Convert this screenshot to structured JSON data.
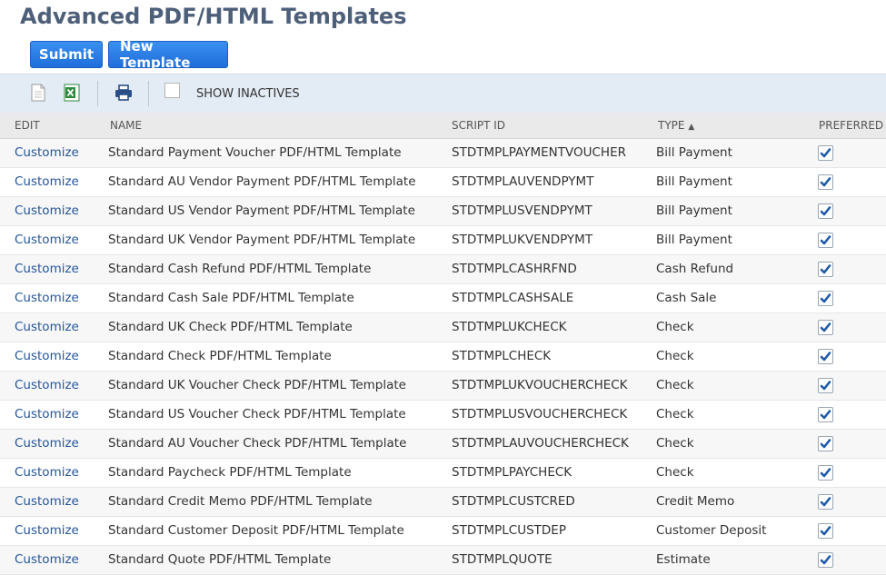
{
  "page": {
    "title": "Advanced PDF/HTML Templates"
  },
  "buttons": {
    "submit": "Submit",
    "new_template": "New Template"
  },
  "toolbar": {
    "show_inactives": "SHOW INACTIVES"
  },
  "columns": {
    "edit": "EDIT",
    "name": "NAME",
    "script_id": "SCRIPT ID",
    "type": "TYPE",
    "sort_indicator": "▲",
    "preferred": "PREFERRED"
  },
  "colors": {
    "title": "#4d5f79",
    "button": "#1f6fdc",
    "link": "#255599",
    "checkmark": "#1e5aa8",
    "toolbar_bg": "#e3ebf4"
  },
  "rows": [
    {
      "edit": "Customize",
      "name": "Standard Payment Voucher PDF/HTML Template",
      "script_id": "STDTMPLPAYMENTVOUCHER",
      "type": "Bill Payment",
      "preferred": true
    },
    {
      "edit": "Customize",
      "name": "Standard AU Vendor Payment PDF/HTML Template",
      "script_id": "STDTMPLAUVENDPYMT",
      "type": "Bill Payment",
      "preferred": true
    },
    {
      "edit": "Customize",
      "name": "Standard US Vendor Payment PDF/HTML Template",
      "script_id": "STDTMPLUSVENDPYMT",
      "type": "Bill Payment",
      "preferred": true
    },
    {
      "edit": "Customize",
      "name": "Standard UK Vendor Payment PDF/HTML Template",
      "script_id": "STDTMPLUKVENDPYMT",
      "type": "Bill Payment",
      "preferred": true
    },
    {
      "edit": "Customize",
      "name": "Standard Cash Refund PDF/HTML Template",
      "script_id": "STDTMPLCASHRFND",
      "type": "Cash Refund",
      "preferred": true
    },
    {
      "edit": "Customize",
      "name": "Standard Cash Sale PDF/HTML Template",
      "script_id": "STDTMPLCASHSALE",
      "type": "Cash Sale",
      "preferred": true
    },
    {
      "edit": "Customize",
      "name": "Standard UK Check PDF/HTML Template",
      "script_id": "STDTMPLUKCHECK",
      "type": "Check",
      "preferred": true
    },
    {
      "edit": "Customize",
      "name": "Standard Check PDF/HTML Template",
      "script_id": "STDTMPLCHECK",
      "type": "Check",
      "preferred": true
    },
    {
      "edit": "Customize",
      "name": "Standard UK Voucher Check PDF/HTML Template",
      "script_id": "STDTMPLUKVOUCHERCHECK",
      "type": "Check",
      "preferred": true
    },
    {
      "edit": "Customize",
      "name": "Standard US Voucher Check PDF/HTML Template",
      "script_id": "STDTMPLUSVOUCHERCHECK",
      "type": "Check",
      "preferred": true
    },
    {
      "edit": "Customize",
      "name": "Standard AU Voucher Check PDF/HTML Template",
      "script_id": "STDTMPLAUVOUCHERCHECK",
      "type": "Check",
      "preferred": true
    },
    {
      "edit": "Customize",
      "name": "Standard Paycheck PDF/HTML Template",
      "script_id": "STDTMPLPAYCHECK",
      "type": "Check",
      "preferred": true
    },
    {
      "edit": "Customize",
      "name": "Standard Credit Memo PDF/HTML Template",
      "script_id": "STDTMPLCUSTCRED",
      "type": "Credit Memo",
      "preferred": true
    },
    {
      "edit": "Customize",
      "name": "Standard Customer Deposit PDF/HTML Template",
      "script_id": "STDTMPLCUSTDEP",
      "type": "Customer Deposit",
      "preferred": true
    },
    {
      "edit": "Customize",
      "name": "Standard Quote PDF/HTML Template",
      "script_id": "STDTMPLQUOTE",
      "type": "Estimate",
      "preferred": true
    }
  ]
}
